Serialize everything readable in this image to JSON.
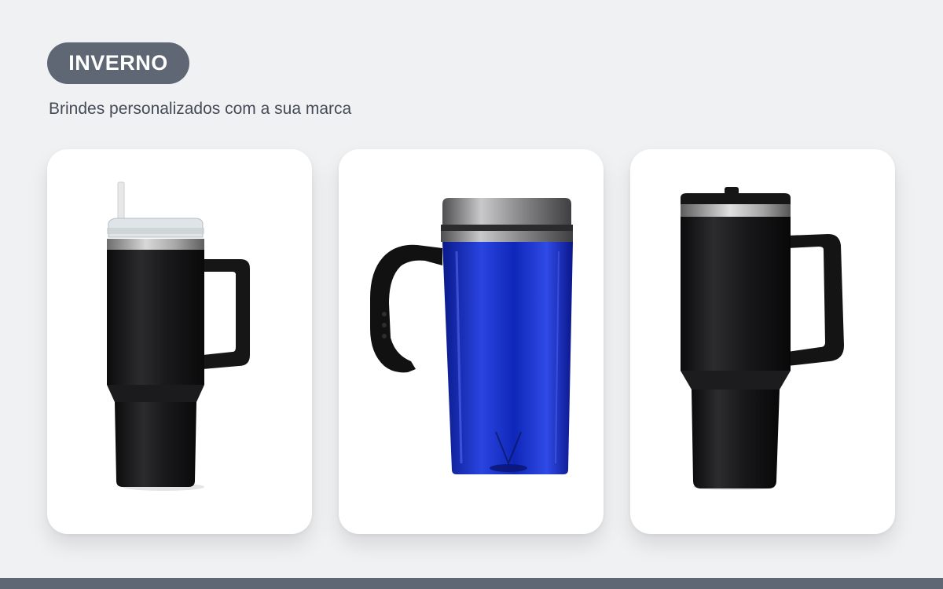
{
  "header": {
    "badge_label": "INVERNO",
    "subtitle": "Brindes personalizados com a sua marca"
  },
  "products": [
    {
      "id": "tumbler-straw",
      "color": "#1c1c1e"
    },
    {
      "id": "travel-mug-blue",
      "color": "#1a2fc4"
    },
    {
      "id": "tumbler-lid",
      "color": "#1a1a1c"
    }
  ],
  "theme": {
    "accent": "#5f6774",
    "background": "#f0f1f3"
  }
}
